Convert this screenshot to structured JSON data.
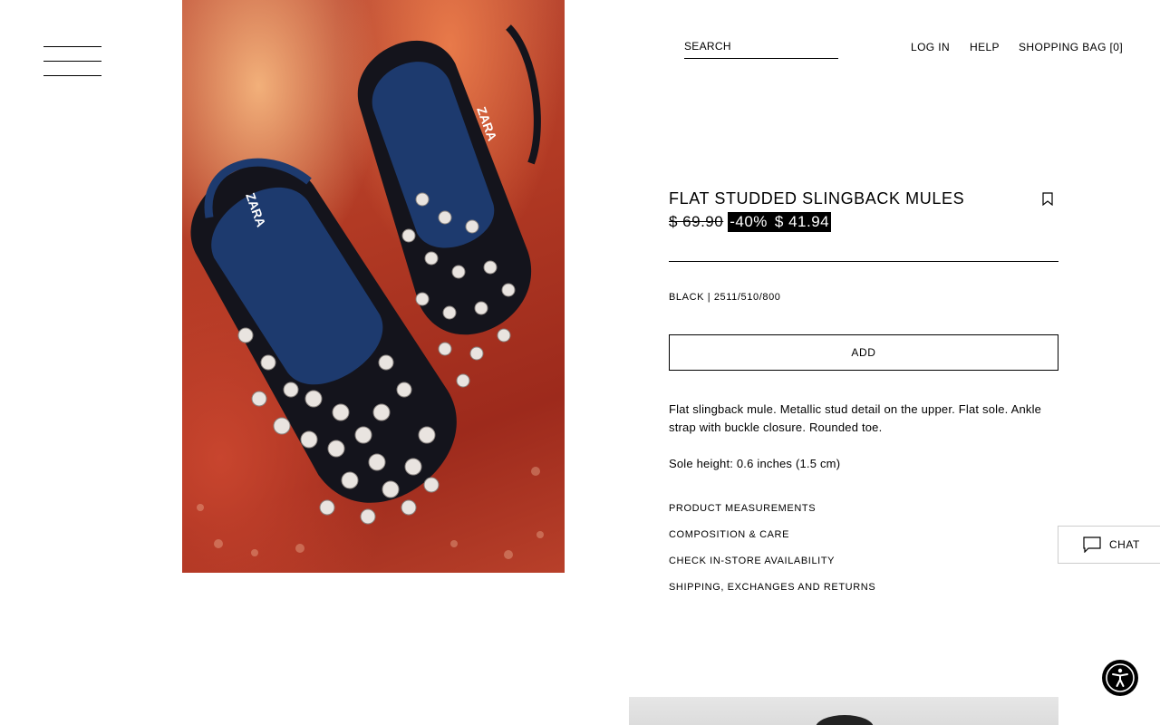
{
  "header": {
    "search_placeholder": "SEARCH",
    "login_label": "LOG IN",
    "help_label": "HELP",
    "bag_label": "SHOPPING BAG [0]"
  },
  "product": {
    "name": "FLAT STUDDED SLINGBACK MULES",
    "old_price": "$ 69.90",
    "discount": "-40%",
    "sale_price": "$ 41.94",
    "color_ref": "BLACK | 2511/510/800",
    "add_label": "ADD",
    "description": "Flat slingback mule. Metallic stud detail on the upper. Flat sole. Ankle strap with buckle closure. Rounded toe.",
    "sole_height": "Sole height: 0.6 inches (1.5 cm)",
    "hero_logo_text": "ZARA"
  },
  "info_links": [
    "PRODUCT MEASUREMENTS",
    "COMPOSITION & CARE",
    "CHECK IN-STORE AVAILABILITY",
    "SHIPPING, EXCHANGES AND RETURNS"
  ],
  "chat": {
    "label": "CHAT"
  },
  "icons": {
    "menu": "hamburger-menu-icon",
    "bookmark": "bookmark-icon",
    "chat": "chat-bubble-icon",
    "accessibility": "accessibility-icon"
  },
  "colors": {
    "text": "#000000",
    "background": "#ffffff",
    "sale_bg": "#000000",
    "sale_text": "#ffffff"
  }
}
